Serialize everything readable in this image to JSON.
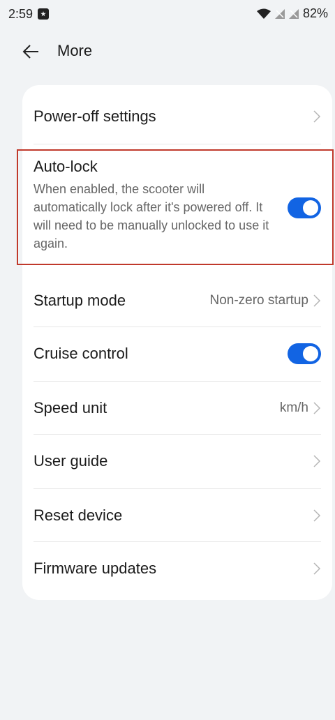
{
  "status_bar": {
    "time": "2:59",
    "battery": "82%"
  },
  "header": {
    "title": "More"
  },
  "settings": {
    "power_off": {
      "label": "Power-off settings"
    },
    "auto_lock": {
      "label": "Auto-lock",
      "description": "When enabled, the scooter will automatically lock after it's powered off. It will need to be manually unlocked to use it again.",
      "enabled": true
    },
    "startup_mode": {
      "label": "Startup mode",
      "value": "Non-zero startup"
    },
    "cruise_control": {
      "label": "Cruise control",
      "enabled": true
    },
    "speed_unit": {
      "label": "Speed unit",
      "value": "km/h"
    },
    "user_guide": {
      "label": "User guide"
    },
    "reset_device": {
      "label": "Reset device"
    },
    "firmware_updates": {
      "label": "Firmware updates"
    }
  },
  "colors": {
    "accent": "#1264e3",
    "background": "#f1f3f5",
    "card": "#ffffff",
    "highlight_border": "#c0392b"
  }
}
